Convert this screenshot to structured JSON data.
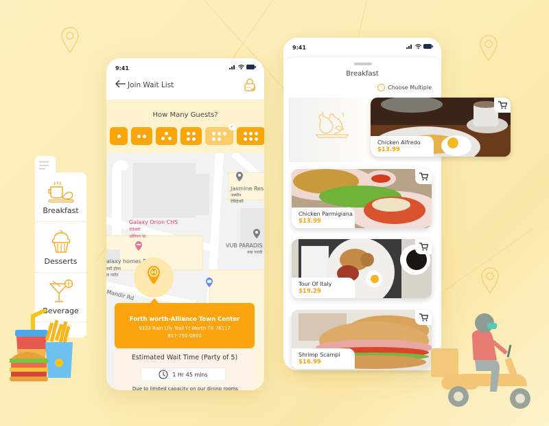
{
  "phone1": {
    "status": {
      "time": "9:41"
    },
    "header": {
      "back_icon": "arrow-left-icon",
      "title": "Join Wait List",
      "lock_icon": "lock-check-icon"
    },
    "guests": {
      "question": "How Many Guests?",
      "options": [
        1,
        2,
        3,
        4,
        5,
        6
      ],
      "selected": 5
    },
    "map": {
      "labels": [
        "Jasmine Res",
        "जस्मीन",
        "रेसिडेन्सी",
        "Galaxy Orion CHS",
        "गॅलेक्सी",
        "ओरियन चा",
        "VUB PARADIS",
        "वाब परादी",
        "alaxy homes R",
        "ल्सी होम्स",
        "ल एस्टेट",
        "Mandir Rd"
      ],
      "label_colors": {
        "poi": "#5f6368",
        "pink": "#d6457a"
      }
    },
    "location": {
      "name": "Forth worth-Alliance Town Center",
      "address": "9333 Rain Lily Trail Ft Worth TX 76117",
      "phone": "817-750-0800"
    },
    "wait": {
      "label": "Estimated Wait Time (Party of 5)",
      "time": "1 Hr 45 mins",
      "note": "Due to limited capacity on our dining rooms"
    }
  },
  "sidemenu": {
    "items": [
      {
        "label": "Breakfast",
        "icon": "coffee-croissant-icon"
      },
      {
        "label": "Desserts",
        "icon": "cupcake-icon"
      },
      {
        "label": "Beverage",
        "icon": "cocktail-icon"
      }
    ],
    "more": "○ ○ ○"
  },
  "phone2": {
    "status": {
      "time": "9:41"
    },
    "title": "Breakfast",
    "choose_multiple": "Choose Multiple",
    "items": [
      {
        "name": "Chicken Alfredo",
        "price": "$13.99"
      },
      {
        "name": "Chicken Parmigiana",
        "price": "$13.99"
      },
      {
        "name": "Tour Of Italy",
        "price": "$19.29"
      },
      {
        "name": "Shrimp Scampi",
        "price": "$16.99"
      }
    ]
  },
  "colors": {
    "accent": "#f9a60c",
    "accent_light": "#fbcd6a",
    "background": "#fdf0c0"
  }
}
